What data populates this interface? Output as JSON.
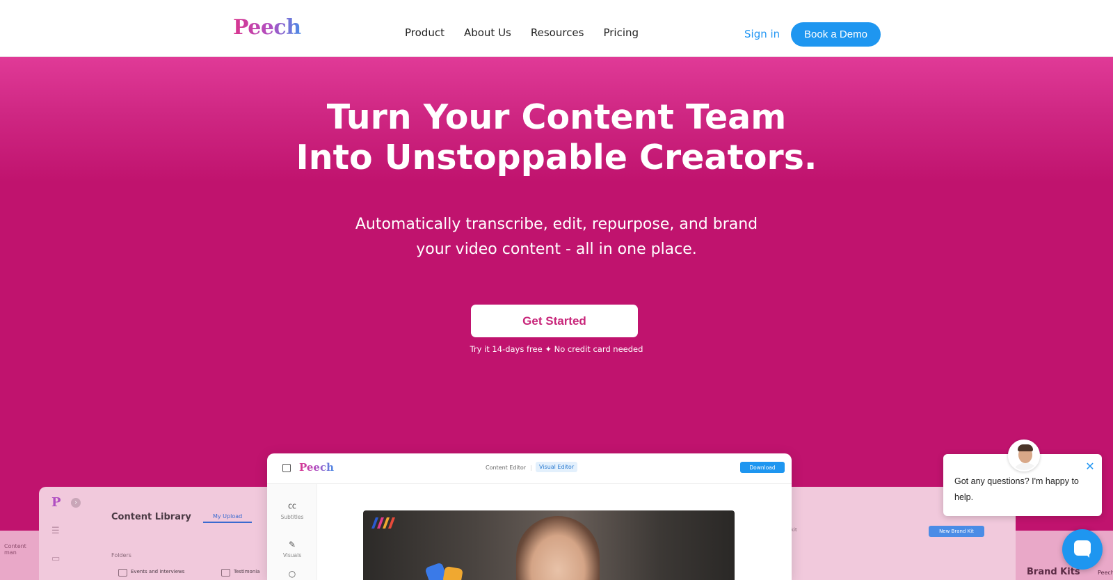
{
  "nav": {
    "logo": "Peech",
    "links": [
      "Product",
      "About Us",
      "Resources",
      "Pricing"
    ],
    "sign_in": "Sign in",
    "demo": "Book a Demo"
  },
  "hero": {
    "title_line1": "Turn Your Content Team",
    "title_line2": "Into Unstoppable Creators.",
    "sub_line1": "Automatically transcribe, edit, repurpose, and brand",
    "sub_line2": "your video content - all in one place.",
    "cta": "Get Started",
    "note": "Try it 14-days free ✦ No credit card needed"
  },
  "library": {
    "logo": "P",
    "title": "Content Library",
    "tab": "My Upload",
    "folders": "Folders",
    "folder1": "Events and interviews",
    "folder2": "Testimonia",
    "edge_label": "Content man"
  },
  "editor": {
    "logo": "Peech",
    "content_editor": "Content Editor",
    "visual_editor": "Visual Editor",
    "download": "Download",
    "side": [
      "Subtitles",
      "Visuals"
    ]
  },
  "brand": {
    "kit": "kit",
    "new_button": "New Brand Kit",
    "title": "Brand Kits",
    "edge_label": "Peech"
  },
  "chat": {
    "message": "Got any questions? I'm happy to help."
  },
  "colors": {
    "hero": "#c0136e",
    "accent": "#1e96f0"
  }
}
